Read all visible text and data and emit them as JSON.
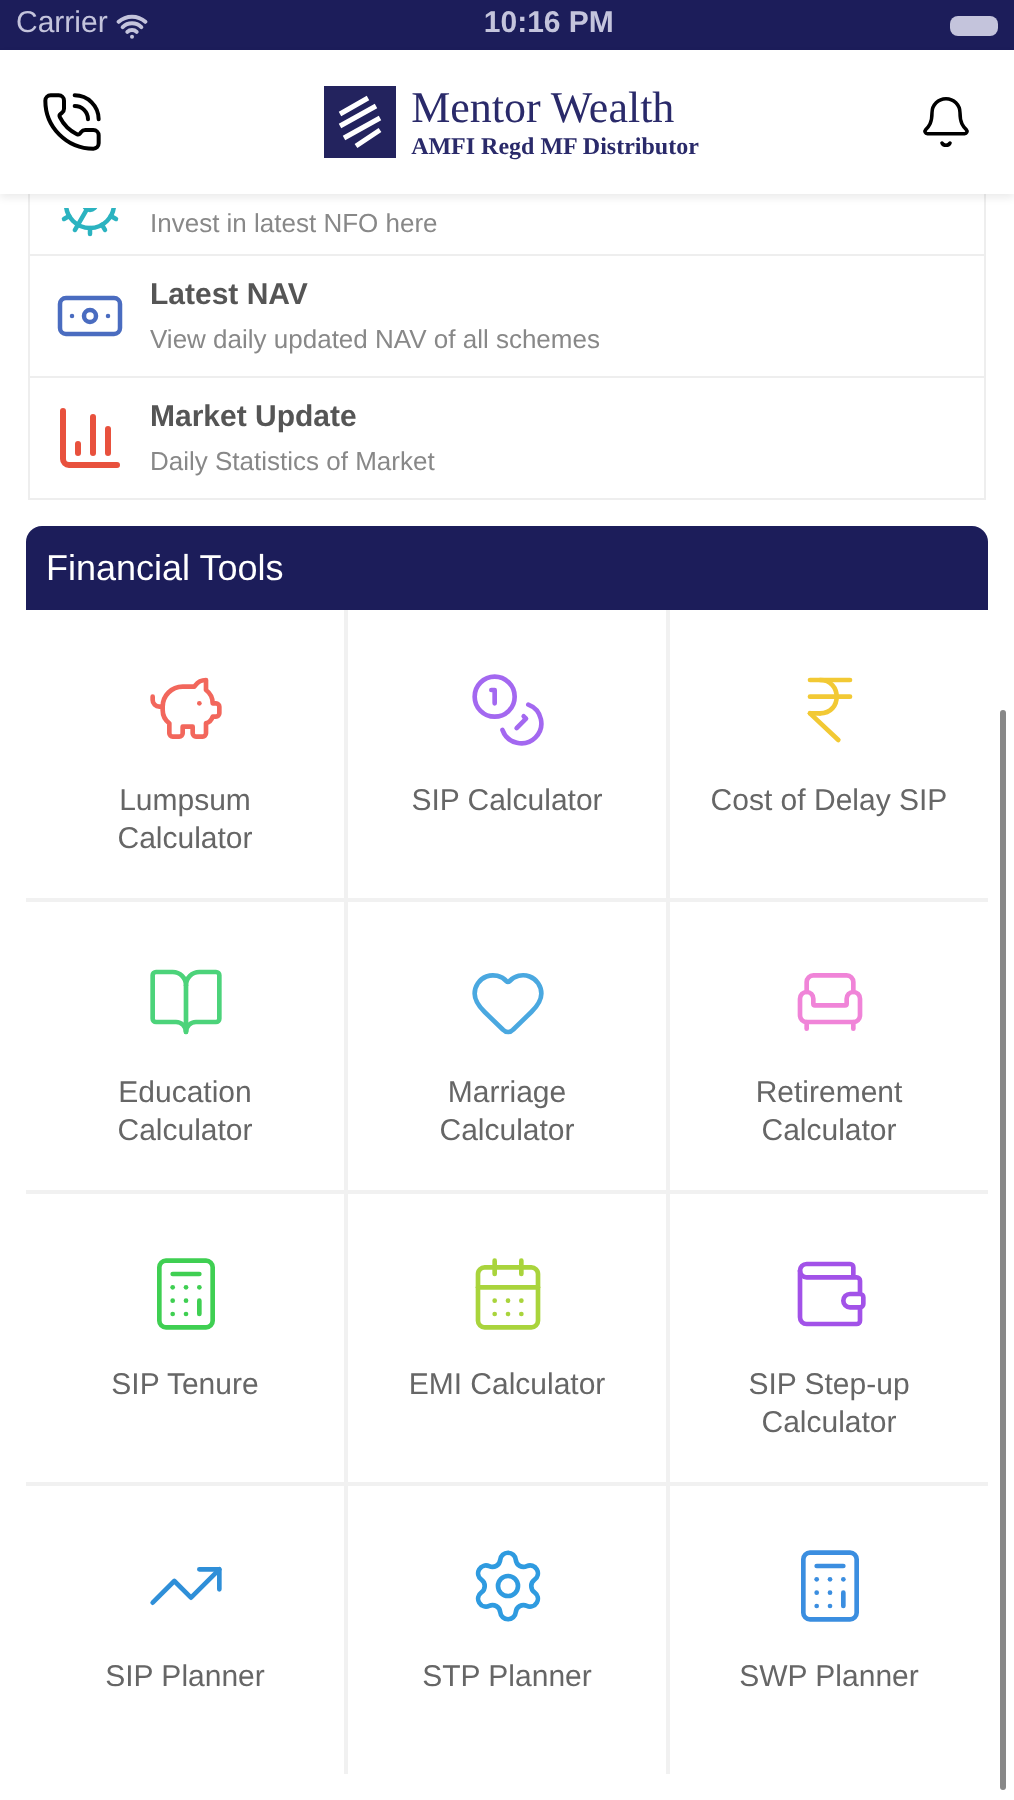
{
  "status_bar": {
    "carrier": "Carrier",
    "time": "10:16 PM"
  },
  "header": {
    "brand": "Mentor Wealth",
    "tagline": "AMFI Regd MF Distributor"
  },
  "links": [
    {
      "kind": "nfo",
      "subtitle": "Invest in latest NFO here"
    },
    {
      "kind": "nav",
      "title": "Latest NAV",
      "subtitle": "View daily updated NAV of all schemes"
    },
    {
      "kind": "market",
      "title": "Market Update",
      "subtitle": "Daily Statistics of Market"
    }
  ],
  "tools_title": "Financial Tools",
  "tools": [
    {
      "kind": "lumpsum",
      "label": "Lumpsum Calculator",
      "color": "#f2675c"
    },
    {
      "kind": "sip",
      "label": "SIP Calculator",
      "color": "#a368f0"
    },
    {
      "kind": "delay",
      "label": "Cost of Delay SIP",
      "color": "#f2c934"
    },
    {
      "kind": "education",
      "label": "Education Calculator",
      "color": "#4cd37a"
    },
    {
      "kind": "marriage",
      "label": "Marriage Calculator",
      "color": "#4aa8e0"
    },
    {
      "kind": "retirement",
      "label": "Retirement Calculator",
      "color": "#f084d8"
    },
    {
      "kind": "tenure",
      "label": "SIP Tenure",
      "color": "#3fcf52"
    },
    {
      "kind": "emi",
      "label": "EMI Calculator",
      "color": "#a9d43c"
    },
    {
      "kind": "stepup",
      "label": "SIP Step-up Calculator",
      "color": "#a252e8"
    },
    {
      "kind": "planner",
      "label": "SIP Planner",
      "color": "#2f8fd8"
    },
    {
      "kind": "stp",
      "label": "STP Planner",
      "color": "#2f9be0"
    },
    {
      "kind": "swp",
      "label": "SWP Planner",
      "color": "#3b8ee0"
    }
  ]
}
